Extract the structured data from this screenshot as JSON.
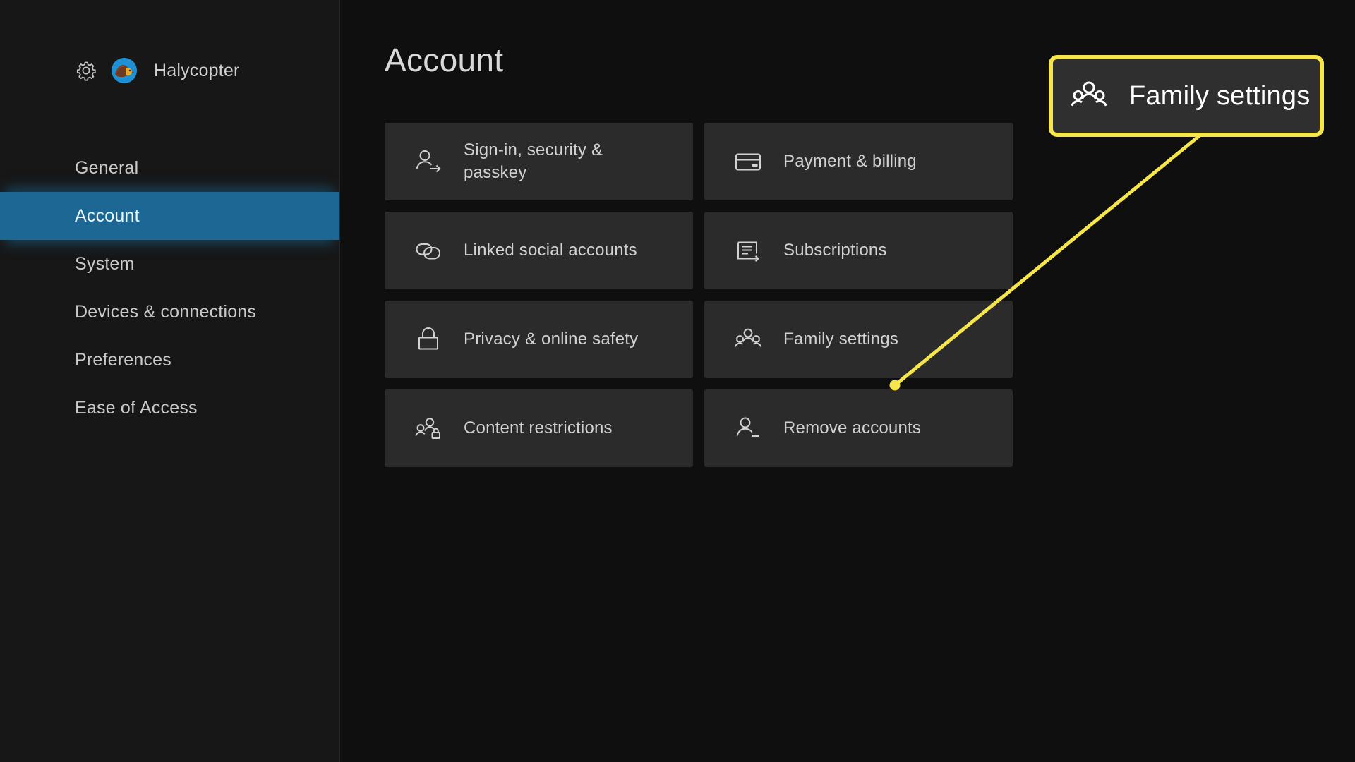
{
  "header": {
    "gear_icon": "gear-icon",
    "avatar_icon": "hedgehog-avatar",
    "gamertag": "Halycopter"
  },
  "sidebar": {
    "items": [
      {
        "label": "General",
        "selected": false
      },
      {
        "label": "Account",
        "selected": true
      },
      {
        "label": "System",
        "selected": false
      },
      {
        "label": "Devices & connections",
        "selected": false
      },
      {
        "label": "Preferences",
        "selected": false
      },
      {
        "label": "Ease of Access",
        "selected": false
      }
    ],
    "selected_bg": "#1c6793"
  },
  "main": {
    "title": "Account",
    "tiles": [
      {
        "label": "Sign-in, security & passkey",
        "icon": "person-arrow-icon"
      },
      {
        "label": "Payment & billing",
        "icon": "credit-card-icon"
      },
      {
        "label": "Linked social accounts",
        "icon": "link-chain-icon"
      },
      {
        "label": "Subscriptions",
        "icon": "document-arrow-icon"
      },
      {
        "label": "Privacy & online safety",
        "icon": "padlock-icon"
      },
      {
        "label": "Family settings",
        "icon": "family-group-icon"
      },
      {
        "label": "Content restrictions",
        "icon": "people-lock-icon"
      },
      {
        "label": "Remove accounts",
        "icon": "person-minus-icon"
      }
    ]
  },
  "callout": {
    "label": "Family settings",
    "icon": "family-group-icon",
    "border_color": "#f6e64a",
    "pointer_color": "#f6e64a"
  }
}
